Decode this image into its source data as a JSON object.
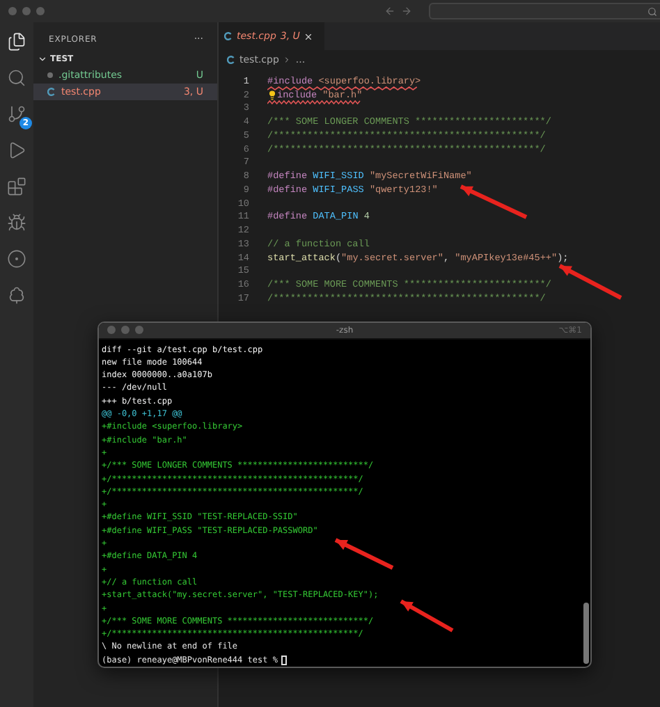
{
  "activity_bar": {
    "items": [
      {
        "kind": "files",
        "selected": true
      },
      {
        "kind": "search",
        "selected": false
      },
      {
        "kind": "source-control",
        "selected": false,
        "badge": "2"
      },
      {
        "kind": "run",
        "selected": false
      },
      {
        "kind": "extensions",
        "selected": false
      },
      {
        "kind": "bug-head",
        "selected": false
      },
      {
        "kind": "branch-circle",
        "selected": false
      },
      {
        "kind": "tree",
        "selected": false
      }
    ]
  },
  "sidebar": {
    "title": "EXPLORER",
    "more": "···",
    "folder": {
      "name": "TEST",
      "expanded": true,
      "children": [
        {
          "name": ".gitattributes",
          "status": "U",
          "color": "#73c991",
          "kind": "dot",
          "selected": false
        },
        {
          "name": "test.cpp",
          "status": "3, U",
          "color": "#f48771",
          "kind": "cpp",
          "selected": true
        }
      ]
    }
  },
  "editor": {
    "tab": {
      "name": "test.cpp",
      "status": "3, U"
    },
    "breadcrumb": [
      "test.cpp",
      "..."
    ],
    "lines": [
      {
        "number": "1",
        "error": true,
        "segments": [
          {
            "kind": "directive",
            "text": "#include"
          },
          {
            "kind": "string",
            "text": " <superfoo.library>"
          }
        ]
      },
      {
        "number": "2",
        "error": true,
        "bulb": true,
        "segments": [
          {
            "kind": "directive",
            "text": "include"
          },
          {
            "kind": "string",
            "text": " \"bar.h\""
          }
        ]
      },
      {
        "number": "3"
      },
      {
        "number": "4",
        "segments": [
          {
            "kind": "comment",
            "text": "/*** SOME LONGER COMMENTS ***********************/"
          }
        ]
      },
      {
        "number": "5",
        "segments": [
          {
            "kind": "comment",
            "text": "/***********************************************/"
          }
        ]
      },
      {
        "number": "6",
        "segments": [
          {
            "kind": "comment",
            "text": "/***********************************************/"
          }
        ]
      },
      {
        "number": "7"
      },
      {
        "number": "8",
        "segments": [
          {
            "kind": "directive",
            "text": "#define"
          },
          {
            "kind": "macro",
            "text": " WIFI_SSID"
          },
          {
            "kind": "string",
            "text": " \"mySecretWiFiName\""
          }
        ]
      },
      {
        "number": "9",
        "segments": [
          {
            "kind": "directive",
            "text": "#define"
          },
          {
            "kind": "macro",
            "text": " WIFI_PASS"
          },
          {
            "kind": "string",
            "text": " \"qwerty123!\""
          }
        ]
      },
      {
        "number": "10"
      },
      {
        "number": "11",
        "segments": [
          {
            "kind": "directive",
            "text": "#define"
          },
          {
            "kind": "macro",
            "text": " DATA_PIN"
          },
          {
            "kind": "number",
            "text": " 4"
          }
        ]
      },
      {
        "number": "12"
      },
      {
        "number": "13",
        "segments": [
          {
            "kind": "comment",
            "text": "// a function call"
          }
        ]
      },
      {
        "number": "14",
        "segments": [
          {
            "kind": "function",
            "text": "start_attack"
          },
          {
            "kind": "plain",
            "text": "("
          },
          {
            "kind": "string",
            "text": "\"my.secret.server\""
          },
          {
            "kind": "plain",
            "text": ", "
          },
          {
            "kind": "string",
            "text": "\"myAPIkey13e#45++\""
          },
          {
            "kind": "plain",
            "text": ");"
          }
        ]
      },
      {
        "number": "15"
      },
      {
        "number": "16",
        "segments": [
          {
            "kind": "comment",
            "text": "/*** SOME MORE COMMENTS *************************/"
          }
        ]
      },
      {
        "number": "17",
        "segments": [
          {
            "kind": "comment",
            "text": "/***********************************************/"
          }
        ]
      }
    ]
  },
  "terminal": {
    "title": "-zsh",
    "shortcut": "⌥⌘1",
    "lines": [
      {
        "kind": "header",
        "text": "diff --git a/test.cpp b/test.cpp"
      },
      {
        "kind": "header",
        "text": "new file mode 100644"
      },
      {
        "kind": "header",
        "text": "index 0000000..a0a107b"
      },
      {
        "kind": "header",
        "text": "--- /dev/null"
      },
      {
        "kind": "header",
        "text": "+++ b/test.cpp"
      },
      {
        "kind": "hunk",
        "text": "@@ -0,0 +1,17 @@"
      },
      {
        "kind": "add",
        "text": "+#include <superfoo.library>"
      },
      {
        "kind": "add",
        "text": "+#include \"bar.h\""
      },
      {
        "kind": "add",
        "text": "+"
      },
      {
        "kind": "add",
        "text": "+/*** SOME LONGER COMMENTS **************************/"
      },
      {
        "kind": "add",
        "text": "+/*************************************************/"
      },
      {
        "kind": "add",
        "text": "+/*************************************************/"
      },
      {
        "kind": "add",
        "text": "+"
      },
      {
        "kind": "add",
        "text": "+#define WIFI_SSID \"TEST-REPLACED-SSID\""
      },
      {
        "kind": "add",
        "text": "+#define WIFI_PASS \"TEST-REPLACED-PASSWORD\""
      },
      {
        "kind": "add",
        "text": "+"
      },
      {
        "kind": "add",
        "text": "+#define DATA_PIN 4"
      },
      {
        "kind": "add",
        "text": "+"
      },
      {
        "kind": "add",
        "text": "+// a function call"
      },
      {
        "kind": "add",
        "text": "+start_attack(\"my.secret.server\", \"TEST-REPLACED-KEY\");"
      },
      {
        "kind": "add",
        "text": "+"
      },
      {
        "kind": "add",
        "text": "+/*** SOME MORE COMMENTS ****************************/"
      },
      {
        "kind": "add",
        "text": "+/*************************************************/"
      },
      {
        "kind": "plain",
        "text": "\\ No newline at end of file"
      }
    ],
    "prompt": "(base) reneaye@MBPvonRene444 test %"
  }
}
